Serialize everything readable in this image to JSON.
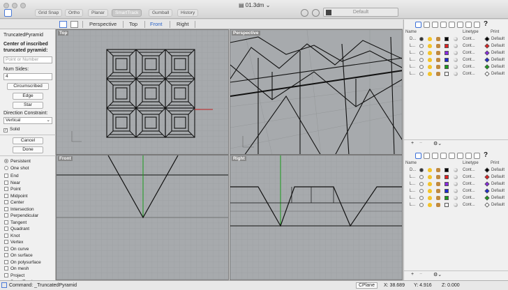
{
  "window": {
    "title": "01.3dm"
  },
  "toolbar": {
    "toggles": [
      "Grid Snap",
      "Ortho",
      "Planar",
      "SmartTrack",
      "Gumball",
      "History"
    ],
    "active_toggle": "SmartTrack",
    "layer": "Default"
  },
  "viewport_tabs": [
    "Perspective",
    "Top",
    "Front",
    "Right"
  ],
  "active_viewport_tab": "Front",
  "command_panel": {
    "title": "TruncatedPyramid",
    "prompt_line1": "Center of inscribed",
    "prompt_line2": "truncated pyramid:",
    "point_placeholder": "Point or Number",
    "num_sides_label": "Num Sides:",
    "num_sides_value": "4",
    "buttons": [
      "Circumscribed",
      "Edge",
      "Star"
    ],
    "direction_label": "Direction Constraint:",
    "direction_value": "Vertical",
    "solid_label": "Solid",
    "cancel_label": "Cancel",
    "done_label": "Done"
  },
  "osnap": {
    "modes": [
      "Persistent",
      "One shot"
    ],
    "items": [
      "End",
      "Near",
      "Point",
      "Midpoint",
      "Center",
      "Intersection",
      "Perpendicular",
      "Tangent",
      "Quadrant",
      "Knot",
      "Vertex",
      "On curve",
      "On surface",
      "On polysurface",
      "On mesh",
      "Project",
      "SmartTrack"
    ],
    "checked": [
      "SmartTrack"
    ]
  },
  "viewports": {
    "top": "Top",
    "perspective": "Perspective",
    "front": "Front",
    "right": "Right"
  },
  "layers_panel": {
    "headers": [
      "Name",
      "Linetype",
      "Print"
    ],
    "rows": [
      {
        "name": "D...",
        "color": "#000000",
        "linetype": "Cont...",
        "print": "Default"
      },
      {
        "name": "L...",
        "color": "#e02020",
        "linetype": "Cont...",
        "print": "Default"
      },
      {
        "name": "L...",
        "color": "#8a2be2",
        "linetype": "Cont...",
        "print": "Default"
      },
      {
        "name": "L...",
        "color": "#1c2ad0",
        "linetype": "Cont...",
        "print": "Default"
      },
      {
        "name": "L...",
        "color": "#1a9a1a",
        "linetype": "Cont...",
        "print": "Default"
      },
      {
        "name": "L...",
        "color": "#ffffff",
        "linetype": "Cont...",
        "print": "Default"
      }
    ],
    "add_symbol": "+",
    "remove_symbol": "−"
  },
  "status": {
    "command": "Command: _TruncatedPyramid",
    "cplane": "CPlane",
    "x": "X: 38.689",
    "y": "Y: 4.916",
    "z": "Z: 0.000"
  }
}
